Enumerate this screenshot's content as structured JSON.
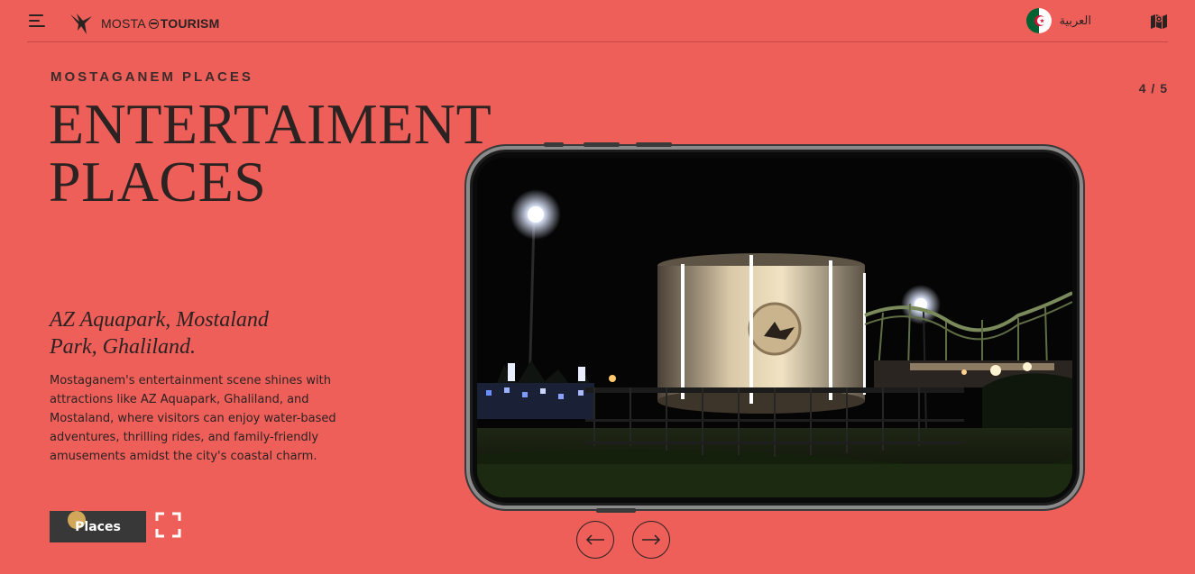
{
  "header": {
    "logo_left": "MOSTA",
    "logo_right": "TOURISM",
    "language_label": "العربية"
  },
  "hero": {
    "eyebrow": "MOSTAGANEM PLACES",
    "counter": "4 / 5",
    "title_line1": "ENTERTAIMENT",
    "title_line2": "PLACES",
    "subtitle": "AZ Aquapark, Mostaland Park, Ghaliland.",
    "description": "Mostaganem's entertainment scene shines with attractions like AZ Aquapark, Ghaliland, and Mostaland, where visitors can enjoy water-based adventures, thrilling rides, and family-friendly amusements amidst the city's coastal charm.",
    "button_label": "Places"
  },
  "icons": {
    "menu": "menu-icon",
    "logo": "bird-logo-icon",
    "flag": "algeria-flag-icon",
    "map": "map-icon",
    "expand": "expand-icon",
    "prev": "arrow-left-icon",
    "next": "arrow-right-icon"
  },
  "colors": {
    "background": "#ef5f59",
    "text": "#2b2222",
    "button": "#383838",
    "button_dot": "#d3a75a"
  }
}
